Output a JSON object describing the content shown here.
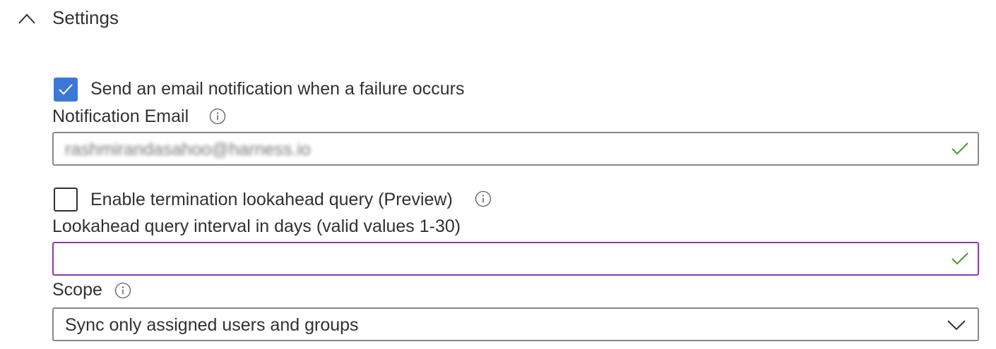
{
  "section": {
    "title": "Settings",
    "expanded": true
  },
  "email_notification": {
    "checkbox_label": "Send an email notification when a failure occurs",
    "checked": true,
    "field_label": "Notification Email",
    "value_obscured": "rashmirandasahoo@harness.io",
    "valid": true
  },
  "lookahead": {
    "checkbox_label": "Enable termination lookahead query (Preview)",
    "checked": false,
    "field_label": "Lookahead query interval in days (valid values 1-30)",
    "value": "",
    "valid": true
  },
  "scope": {
    "field_label": "Scope",
    "selected": "Sync only assigned users and groups"
  },
  "colors": {
    "accent": "#3b78d8",
    "valid_check": "#4c9a2a",
    "focus_border": "#8a3aa8",
    "border": "#8a8886"
  },
  "icons": [
    "chevron-up-icon",
    "checkmark-icon",
    "info-icon",
    "valid-check-icon",
    "chevron-down-icon"
  ]
}
